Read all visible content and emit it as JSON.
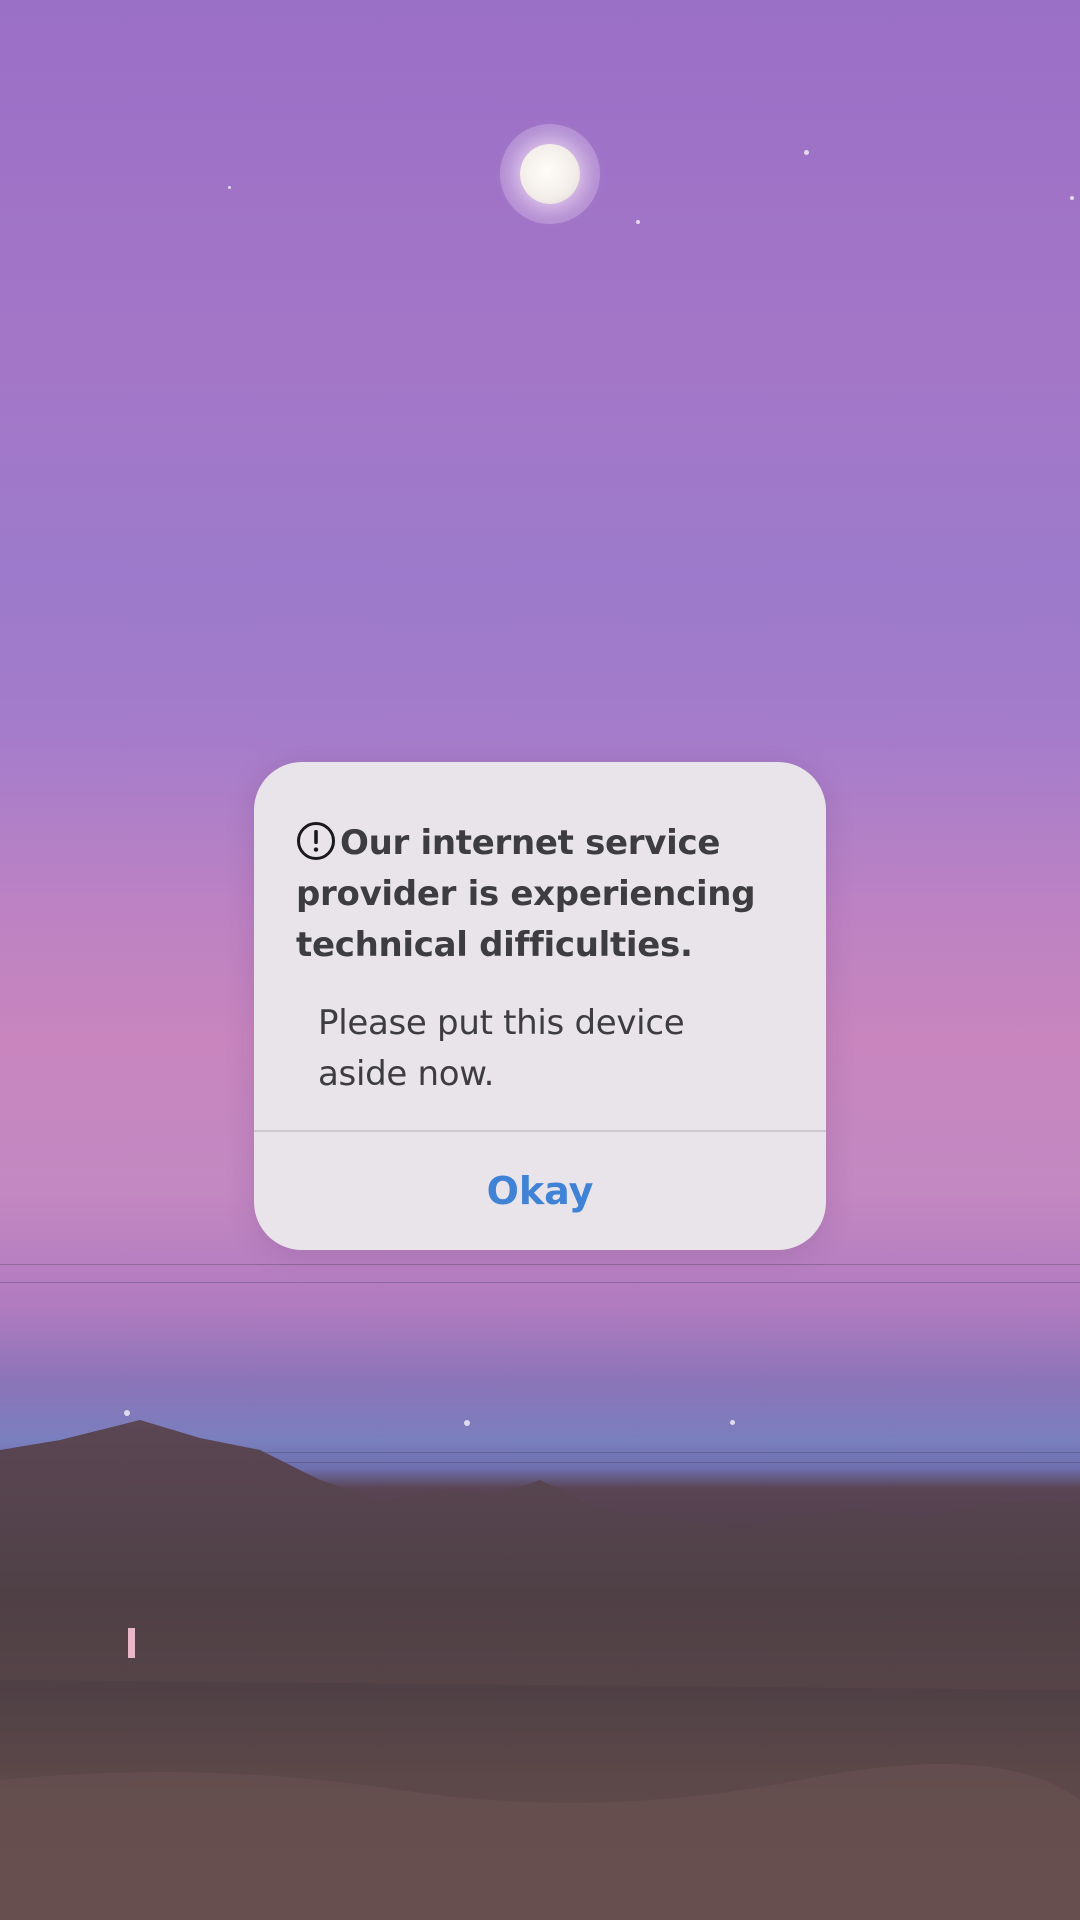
{
  "dialog": {
    "icon": "exclamation-circle-icon",
    "title": "Our internet service provider is experiencing technical difficulties.",
    "message": "Please put this device aside now.",
    "ok_label": "Okay",
    "ok_color": "#3f82d6"
  },
  "wallpaper": {
    "description_icon": "moon-icon"
  }
}
